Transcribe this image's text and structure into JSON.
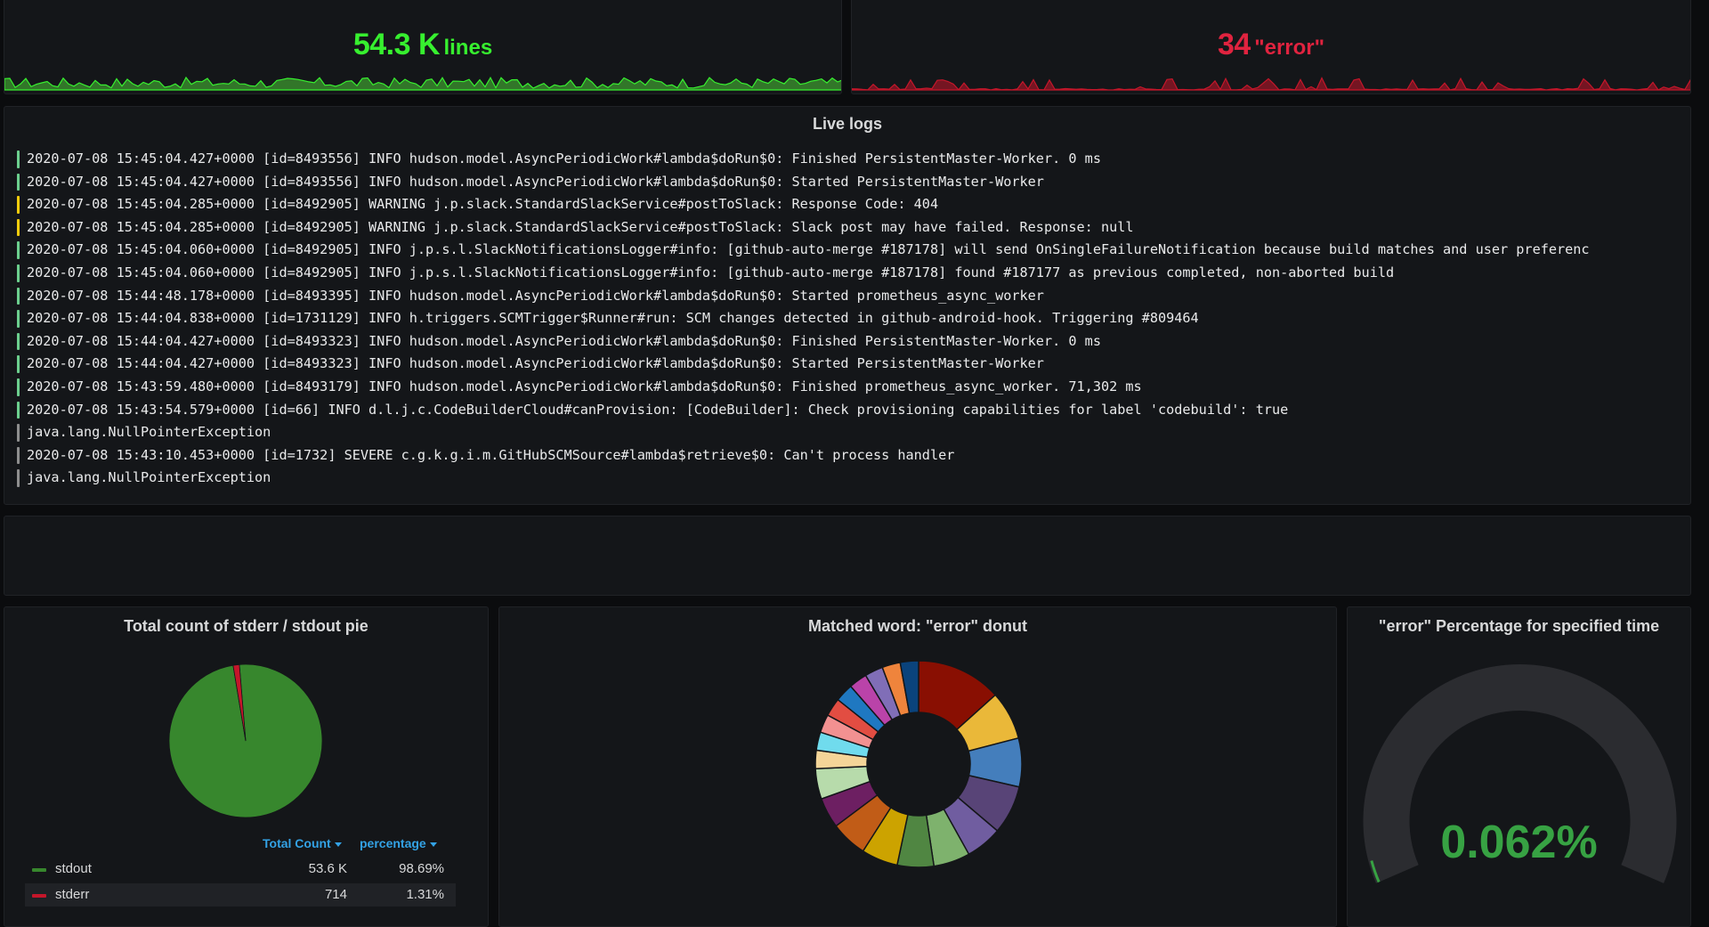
{
  "stat_lines": {
    "value": "54.3 K",
    "unit": "lines",
    "color": "#37f02f"
  },
  "stat_error": {
    "value": "34",
    "unit": "\"error\"",
    "color": "#e0233f"
  },
  "live_logs": {
    "title": "Live logs",
    "rows": [
      {
        "level": "info",
        "text": "2020-07-08 15:45:04.427+0000 [id=8493556] INFO hudson.model.AsyncPeriodicWork#lambda$doRun$0: Finished PersistentMaster-Worker. 0 ms"
      },
      {
        "level": "info",
        "text": "2020-07-08 15:45:04.427+0000 [id=8493556] INFO hudson.model.AsyncPeriodicWork#lambda$doRun$0: Started PersistentMaster-Worker"
      },
      {
        "level": "warning",
        "text": "2020-07-08 15:45:04.285+0000 [id=8492905] WARNING j.p.slack.StandardSlackService#postToSlack: Response Code: 404"
      },
      {
        "level": "warning",
        "text": "2020-07-08 15:45:04.285+0000 [id=8492905] WARNING j.p.slack.StandardSlackService#postToSlack: Slack post may have failed. Response: null"
      },
      {
        "level": "info",
        "text": "2020-07-08 15:45:04.060+0000 [id=8492905] INFO j.p.s.l.SlackNotificationsLogger#info: [github-auto-merge #187178] will send OnSingleFailureNotification because build matches and user preferenc"
      },
      {
        "level": "info",
        "text": "2020-07-08 15:45:04.060+0000 [id=8492905] INFO j.p.s.l.SlackNotificationsLogger#info: [github-auto-merge #187178] found #187177 as previous completed, non-aborted build"
      },
      {
        "level": "info",
        "text": "2020-07-08 15:44:48.178+0000 [id=8493395] INFO hudson.model.AsyncPeriodicWork#lambda$doRun$0: Started prometheus_async_worker"
      },
      {
        "level": "info",
        "text": "2020-07-08 15:44:04.838+0000 [id=1731129] INFO h.triggers.SCMTrigger$Runner#run: SCM changes detected in github-android-hook. Triggering #809464"
      },
      {
        "level": "info",
        "text": "2020-07-08 15:44:04.427+0000 [id=8493323] INFO hudson.model.AsyncPeriodicWork#lambda$doRun$0: Finished PersistentMaster-Worker. 0 ms"
      },
      {
        "level": "info",
        "text": "2020-07-08 15:44:04.427+0000 [id=8493323] INFO hudson.model.AsyncPeriodicWork#lambda$doRun$0: Started PersistentMaster-Worker"
      },
      {
        "level": "info",
        "text": "2020-07-08 15:43:59.480+0000 [id=8493179] INFO hudson.model.AsyncPeriodicWork#lambda$doRun$0: Finished prometheus_async_worker. 71,302 ms"
      },
      {
        "level": "info",
        "text": "2020-07-08 15:43:54.579+0000 [id=66] INFO d.l.j.c.CodeBuilderCloud#canProvision: [CodeBuilder]: Check provisioning capabilities for label 'codebuild': true"
      },
      {
        "level": "unknown",
        "text": "java.lang.NullPointerException"
      },
      {
        "level": "unknown",
        "text": "2020-07-08 15:43:10.453+0000 [id=1732] SEVERE c.g.k.g.i.m.GitHubSCMSource#lambda$retrieve$0: Can't process handler"
      },
      {
        "level": "unknown",
        "text": "java.lang.NullPointerException"
      }
    ],
    "level_colors": {
      "info": "#6ccf8e",
      "warning": "#f2cc0c",
      "unknown": "#8e8e8e"
    }
  },
  "pie_panel": {
    "title": "Total count of stderr / stdout pie",
    "headers": {
      "count": "Total Count",
      "percent": "percentage"
    },
    "rows": [
      {
        "name": "stdout",
        "count": "53.6 K",
        "percent": "98.69%",
        "color": "#37872d"
      },
      {
        "name": "stderr",
        "count": "714",
        "percent": "1.31%",
        "color": "#c4162a"
      }
    ]
  },
  "donut_panel": {
    "title": "Matched word: \"error\" donut"
  },
  "gauge_panel": {
    "title": "\"error\" Percentage for specified time",
    "value": "0.062%",
    "fraction": 0.00062,
    "color": "#37a243"
  },
  "chart_data": [
    {
      "type": "pie",
      "title": "Total count of stderr / stdout pie",
      "labels": [
        "stdout",
        "stderr"
      ],
      "values": [
        53600,
        714
      ],
      "colors": [
        "#37872d",
        "#c4162a"
      ]
    },
    {
      "type": "pie",
      "title": "Matched word: \"error\" donut",
      "donut": true,
      "values": [
        14,
        8,
        8,
        8,
        6,
        6,
        6,
        6,
        6,
        5,
        5,
        3,
        3,
        3,
        3,
        3,
        3,
        3,
        3,
        3
      ],
      "colors": [
        "#890f02",
        "#eab839",
        "#447ebc",
        "#584477",
        "#705da0",
        "#7eb26d",
        "#508642",
        "#cca300",
        "#c15c17",
        "#6d1f62",
        "#b7dbab",
        "#f4d598",
        "#70dbed",
        "#f29191",
        "#e24d42",
        "#1f78c1",
        "#ba43a9",
        "#806eb7",
        "#ef843c",
        "#0a437c"
      ]
    }
  ]
}
